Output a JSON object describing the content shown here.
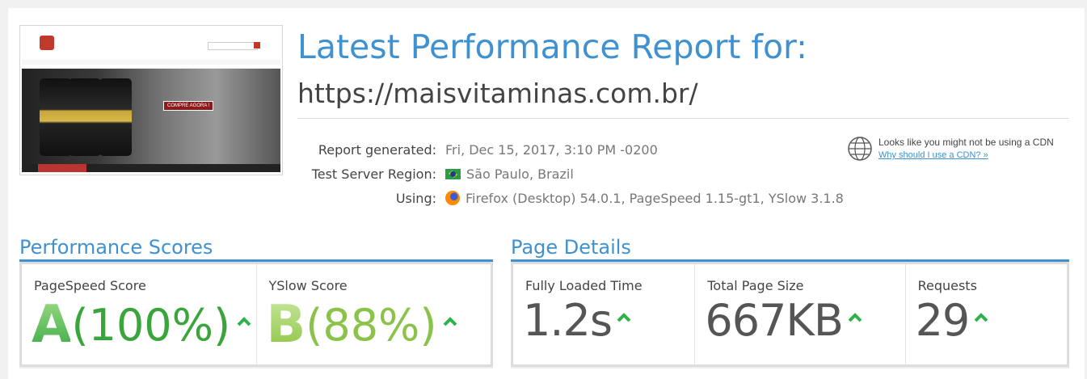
{
  "header": {
    "title": "Latest Performance Report for:",
    "url": "https://maisvitaminas.com.br/"
  },
  "thumbnail": {
    "hero_cta": "COMPRE AGORA !"
  },
  "meta": [
    {
      "label": "Report generated:",
      "value": "Fri, Dec 15, 2017, 3:10 PM -0200",
      "icon": "none"
    },
    {
      "label": "Test Server Region:",
      "value": "São Paulo, Brazil",
      "icon": "brazil-flag-icon"
    },
    {
      "label": "Using:",
      "value": "Firefox (Desktop) 54.0.1, PageSpeed 1.15-gt1, YSlow 3.1.8",
      "icon": "firefox-icon"
    }
  ],
  "cdn": {
    "text": "Looks like you might not be using a CDN",
    "link": "Why should I use a CDN? »"
  },
  "performance": {
    "title": "Performance Scores",
    "pagespeed": {
      "label": "PageSpeed Score",
      "grade": "A",
      "percent": "(100%)"
    },
    "yslow": {
      "label": "YSlow Score",
      "grade": "B",
      "percent": "(88%)"
    }
  },
  "details": {
    "title": "Page Details",
    "fully_loaded": {
      "label": "Fully Loaded Time",
      "value": "1.2s"
    },
    "page_size": {
      "label": "Total Page Size",
      "value": "667KB"
    },
    "requests": {
      "label": "Requests",
      "value": "29"
    }
  },
  "colors": {
    "accent": "#3f91d0",
    "grade_a": "#30b34a",
    "grade_b": "#8bc34a",
    "arrow": "#2eb24a"
  }
}
